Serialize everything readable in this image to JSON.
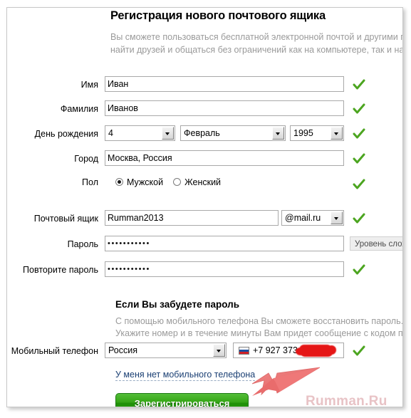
{
  "header": {
    "title": "Регистрация нового почтового ящика",
    "subtitle_line1": "Вы сможете пользоваться бесплатной электронной почтой и другими п",
    "subtitle_line2": "найти друзей и общаться без ограничений как на компьютере, так и на"
  },
  "form": {
    "first_name": {
      "label": "Имя",
      "value": "Иван",
      "valid": "check-icon"
    },
    "last_name": {
      "label": "Фамилия",
      "value": "Иванов",
      "valid": "check-icon"
    },
    "birthday": {
      "label": "День рождения",
      "day": "4",
      "month": "Февраль",
      "year": "1995",
      "valid": "check-icon"
    },
    "city": {
      "label": "Город",
      "value": "Москва, Россия",
      "valid": "check-icon"
    },
    "gender": {
      "label": "Пол",
      "male": "Мужской",
      "female": "Женский",
      "selected": "male",
      "valid": "check-icon"
    },
    "mailbox": {
      "label": "Почтовый ящик",
      "value": "Rumman2013",
      "domain": "@mail.ru",
      "valid": "check-icon"
    },
    "password": {
      "label": "Пароль",
      "value": "•••••••••••",
      "tooltip": "Уровень сложн"
    },
    "password_repeat": {
      "label": "Повторите пароль",
      "value": "•••••••••••",
      "valid": "check-icon"
    }
  },
  "forgot": {
    "title": "Если Вы забудете пароль",
    "line1": "С помощью мобильного телефона Вы сможете восстановить пароль.",
    "line2": "Укажите номер и в течение минуты Вам придет сообщение с кодом под"
  },
  "phone": {
    "label": "Мобильный телефон",
    "country": "Россия",
    "flag": "russia-flag-icon",
    "number": "+7 927 373-",
    "redacted": true,
    "valid": "check-icon"
  },
  "links": {
    "no_phone": "У меня нет мобильного телефона"
  },
  "actions": {
    "register": "Зарегистрироваться"
  },
  "watermark": "Rumman.Ru",
  "colors": {
    "check_green": "#4ca520",
    "button_green": "#35a516",
    "arrow_red": "#ef6b6b",
    "watermark_pink": "#e8c3c6",
    "label_gray": "#9a9a9a",
    "redact_red": "#e51616"
  }
}
